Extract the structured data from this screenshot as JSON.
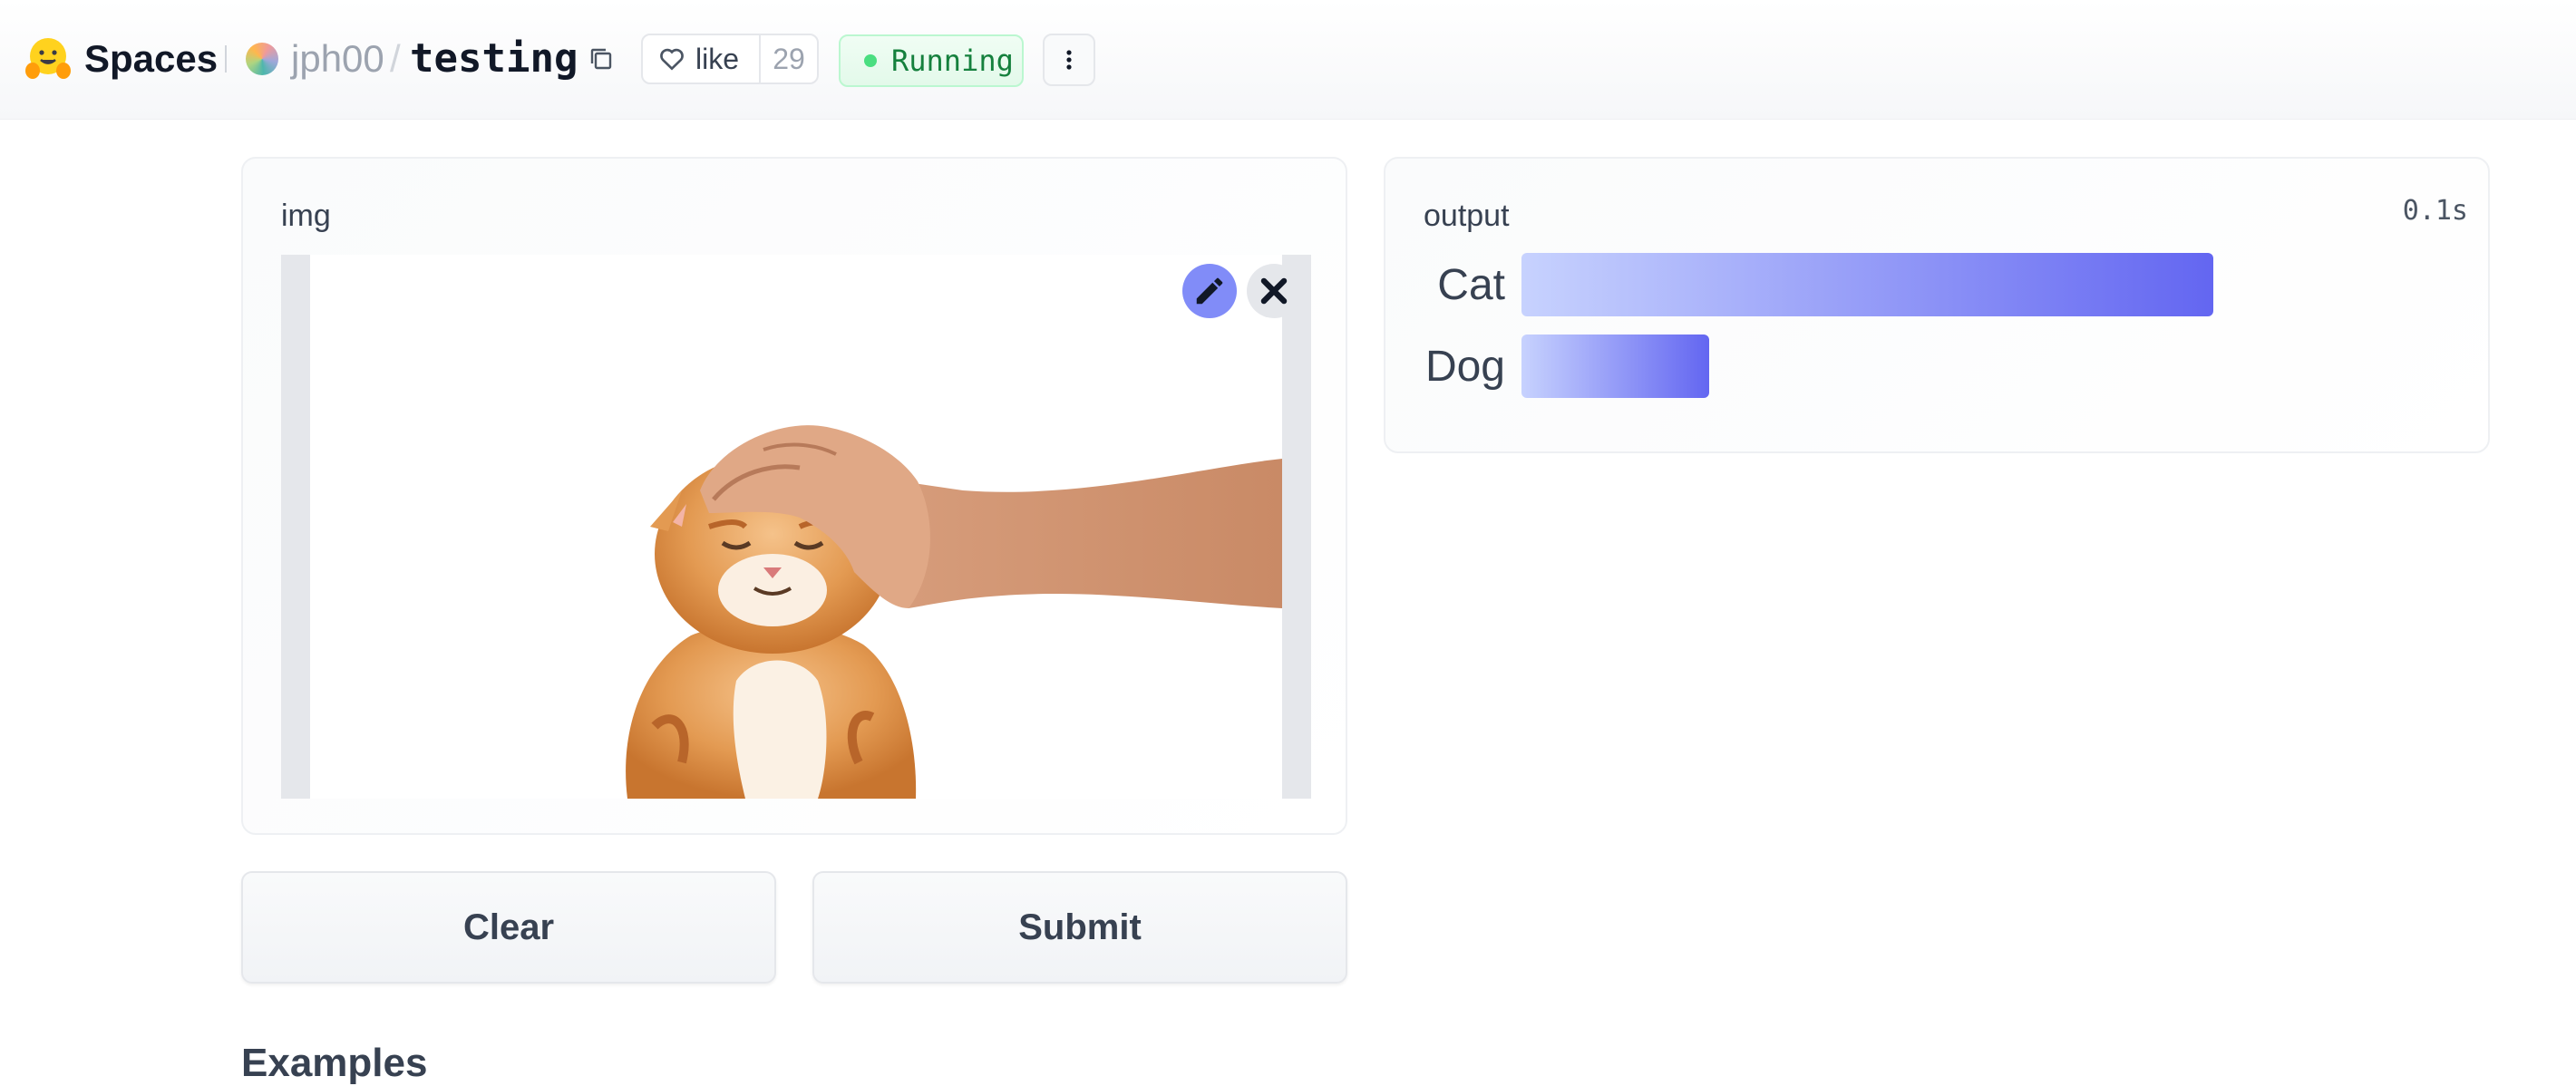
{
  "header": {
    "section": "Spaces",
    "owner": "jph00",
    "separator": "/",
    "repo": "testing",
    "like_label": "like",
    "like_count": "29",
    "status": "Running",
    "status_color": "#15803d"
  },
  "input": {
    "label": "img",
    "image_alt": "orange cat being petted on the head by a hand",
    "clear_label": "Clear",
    "submit_label": "Submit"
  },
  "output": {
    "label": "output",
    "duration": "0.1s",
    "confidences": [
      {
        "label": "Cat",
        "value": 0.7
      },
      {
        "label": "Dog",
        "value": 0.19
      }
    ],
    "bar_gradient": [
      "#c7d2fe",
      "#6366f1"
    ]
  },
  "examples": {
    "heading": "Examples"
  }
}
